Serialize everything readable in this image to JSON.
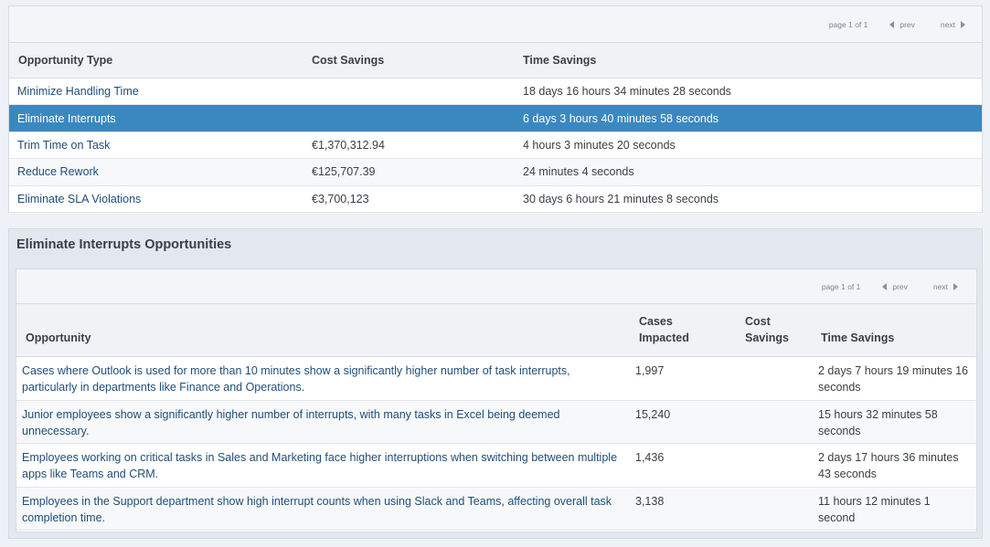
{
  "top_table": {
    "pager": {
      "page_info": "page 1 of 1",
      "prev": "prev",
      "next": "next"
    },
    "headers": [
      "Opportunity Type",
      "Cost Savings",
      "Time Savings"
    ],
    "rows": [
      {
        "type": "Minimize Handling Time",
        "cost": "",
        "time": "18 days 16 hours 34 minutes 28 seconds"
      },
      {
        "type": "Eliminate Interrupts",
        "cost": "",
        "time": "6 days 3 hours 40 minutes 58 seconds"
      },
      {
        "type": "Trim Time on Task",
        "cost": "€1,370,312.94",
        "time": "4 hours 3 minutes 20 seconds"
      },
      {
        "type": "Reduce Rework",
        "cost": "€125,707.39",
        "time": "24 minutes 4 seconds"
      },
      {
        "type": "Eliminate SLA Violations",
        "cost": "€3,700,123",
        "time": "30 days 6 hours 21 minutes 8 seconds"
      }
    ],
    "selected_row": 1,
    "selected_color": "#3a88c0"
  },
  "detail": {
    "title": "Eliminate Interrupts Opportunities",
    "pager": {
      "page_info": "page 1 of 1",
      "prev": "prev",
      "next": "next"
    },
    "headers": {
      "opportunity": "Opportunity",
      "cases_line1": "Cases",
      "cases_line2": "Impacted",
      "cost_line1": "Cost",
      "cost_line2": "Savings",
      "time": "Time Savings"
    },
    "rows": [
      {
        "opportunity": "Cases where Outlook is used for more than 10 minutes show a significantly higher number of task interrupts, particularly in departments like Finance and Operations.",
        "cases": "1,997",
        "cost": "",
        "time": "2 days 7 hours 19 minutes 16 seconds"
      },
      {
        "opportunity": "Junior employees show a significantly higher number of interrupts, with many tasks in Excel being deemed unnecessary.",
        "cases": "15,240",
        "cost": "",
        "time": "15 hours 32 minutes 58 seconds"
      },
      {
        "opportunity": "Employees working on critical tasks in Sales and Marketing face higher interruptions when switching between multiple apps like Teams and CRM.",
        "cases": "1,436",
        "cost": "",
        "time": "2 days 17 hours 36 minutes 43 seconds"
      },
      {
        "opportunity": "Employees in the Support department show high interrupt counts when using Slack and Teams, affecting overall task completion time.",
        "cases": "3,138",
        "cost": "",
        "time": "11 hours 12 minutes 1 second"
      }
    ]
  }
}
